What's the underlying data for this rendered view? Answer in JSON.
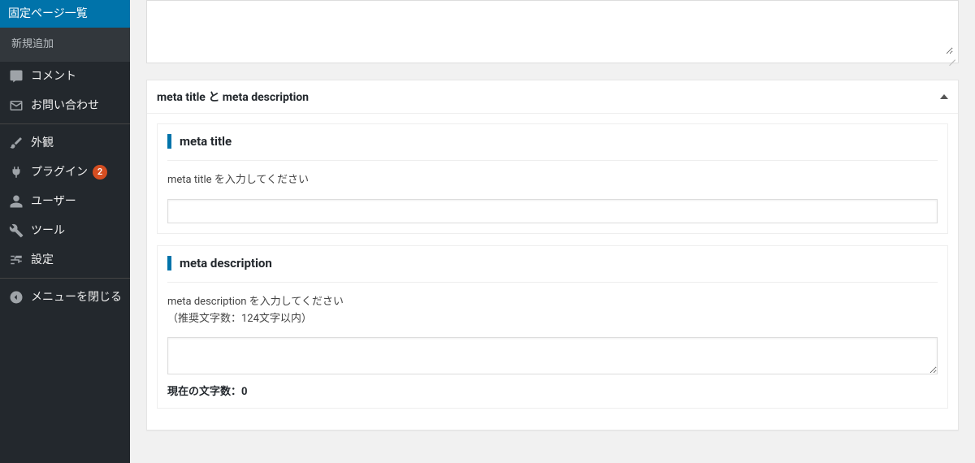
{
  "sidebar": {
    "current_section_label": "固定ページ一覧",
    "submenu": {
      "add_new": "新規追加"
    },
    "items": {
      "comments": "コメント",
      "contact": "お問い合わせ",
      "appearance": "外観",
      "plugins": "プラグイン",
      "plugins_badge": "2",
      "users": "ユーザー",
      "tools": "ツール",
      "settings": "設定",
      "collapse": "メニューを閉じる"
    }
  },
  "main": {
    "postbox_title": "meta title と meta description",
    "meta_title": {
      "heading": "meta title",
      "help": "meta title を入力してください",
      "value": ""
    },
    "meta_description": {
      "heading": "meta description",
      "help_line1": "meta description を入力してください",
      "help_line2": "（推奨文字数：124文字以内）",
      "value": "",
      "count_label": "現在の文字数：",
      "count_value": "0"
    }
  }
}
